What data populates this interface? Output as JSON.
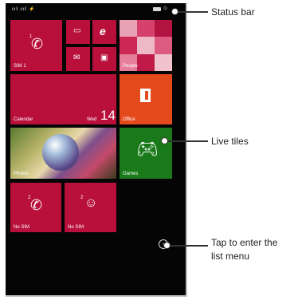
{
  "status_bar": {
    "signal": "ııl ııl ⚡",
    "clock": "⊙"
  },
  "tiles": {
    "sim1": {
      "label": "SIM 1",
      "badge": "1"
    },
    "people": {
      "label": "People"
    },
    "calendar": {
      "label": "Calendar",
      "day": "Wed",
      "date": "14"
    },
    "office": {
      "label": "Office"
    },
    "photos": {
      "label": "Photos"
    },
    "games": {
      "label": "Games"
    },
    "nosim_phone": {
      "label": "No SIM",
      "badge": "2"
    },
    "nosim_msg": {
      "label": "No SIM",
      "badge": "2"
    }
  },
  "annotations": {
    "status_bar": "Status bar",
    "live_tiles": "Live tiles",
    "list_menu_line1": "Tap to enter the",
    "list_menu_line2": "list menu"
  },
  "colors": {
    "tile_red": "#b80f3b",
    "office_orange": "#e34a1c",
    "games_green": "#1a7a1a"
  }
}
